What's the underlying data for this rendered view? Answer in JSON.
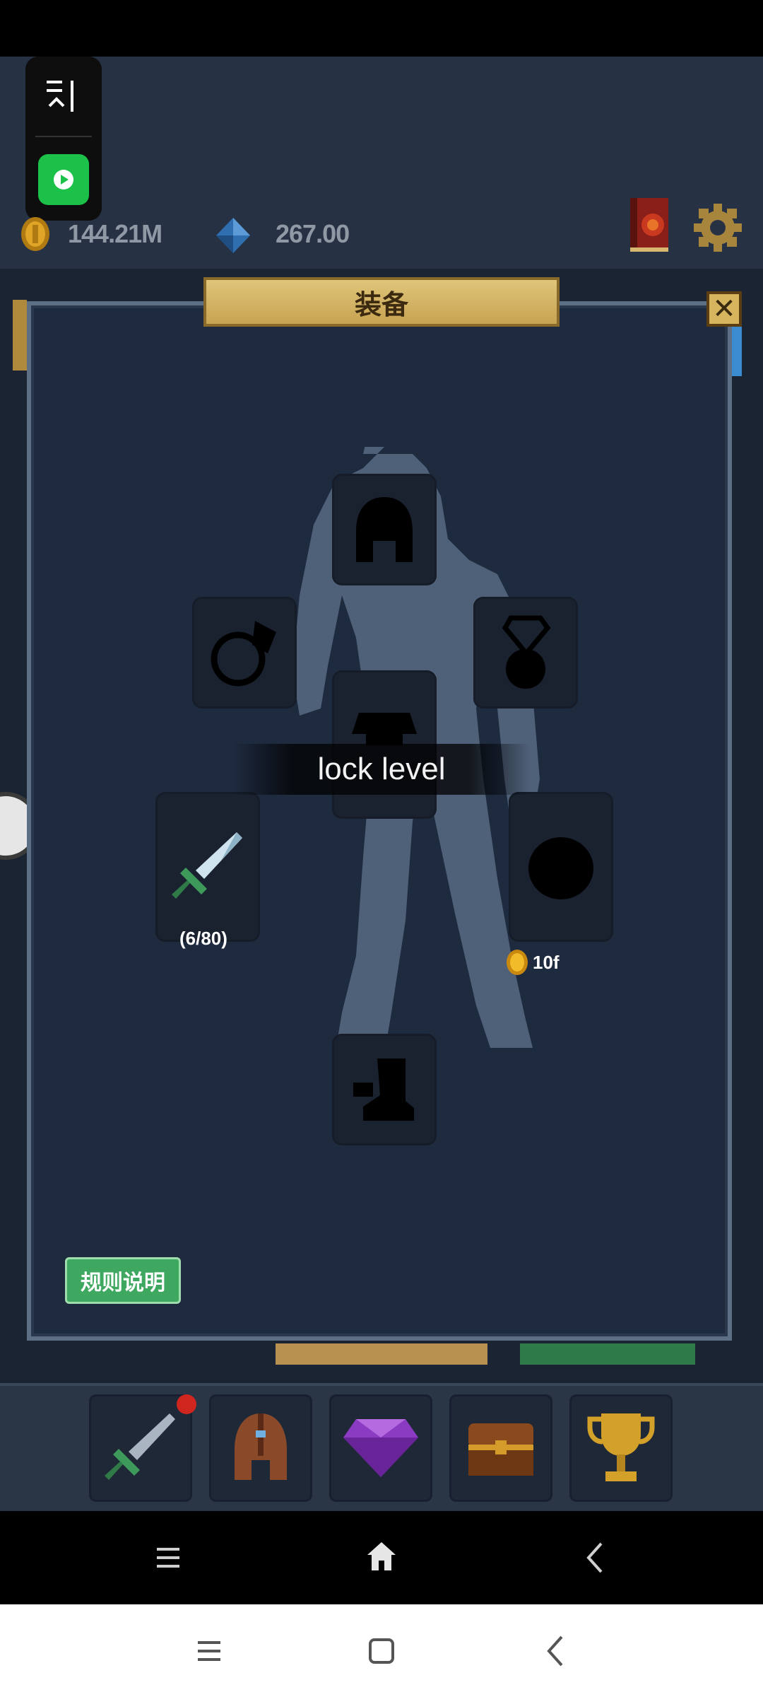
{
  "resources": {
    "gold": "144.21M",
    "gems": "267.00"
  },
  "panel": {
    "title": "装备",
    "close_label": "✕"
  },
  "slots": {
    "weapon": {
      "progress": "(6/80)"
    },
    "accessory": {
      "cost": "10f"
    }
  },
  "toast": {
    "text": "lock level"
  },
  "rules_button": {
    "label": "规则说明"
  },
  "bottom_tabs": [
    "sword",
    "helmet",
    "gem",
    "chest",
    "trophy"
  ],
  "colors": {
    "gold_banner": "#d4b461",
    "rules_green": "#3fa860",
    "panel_bg": "#1e2a3e"
  }
}
